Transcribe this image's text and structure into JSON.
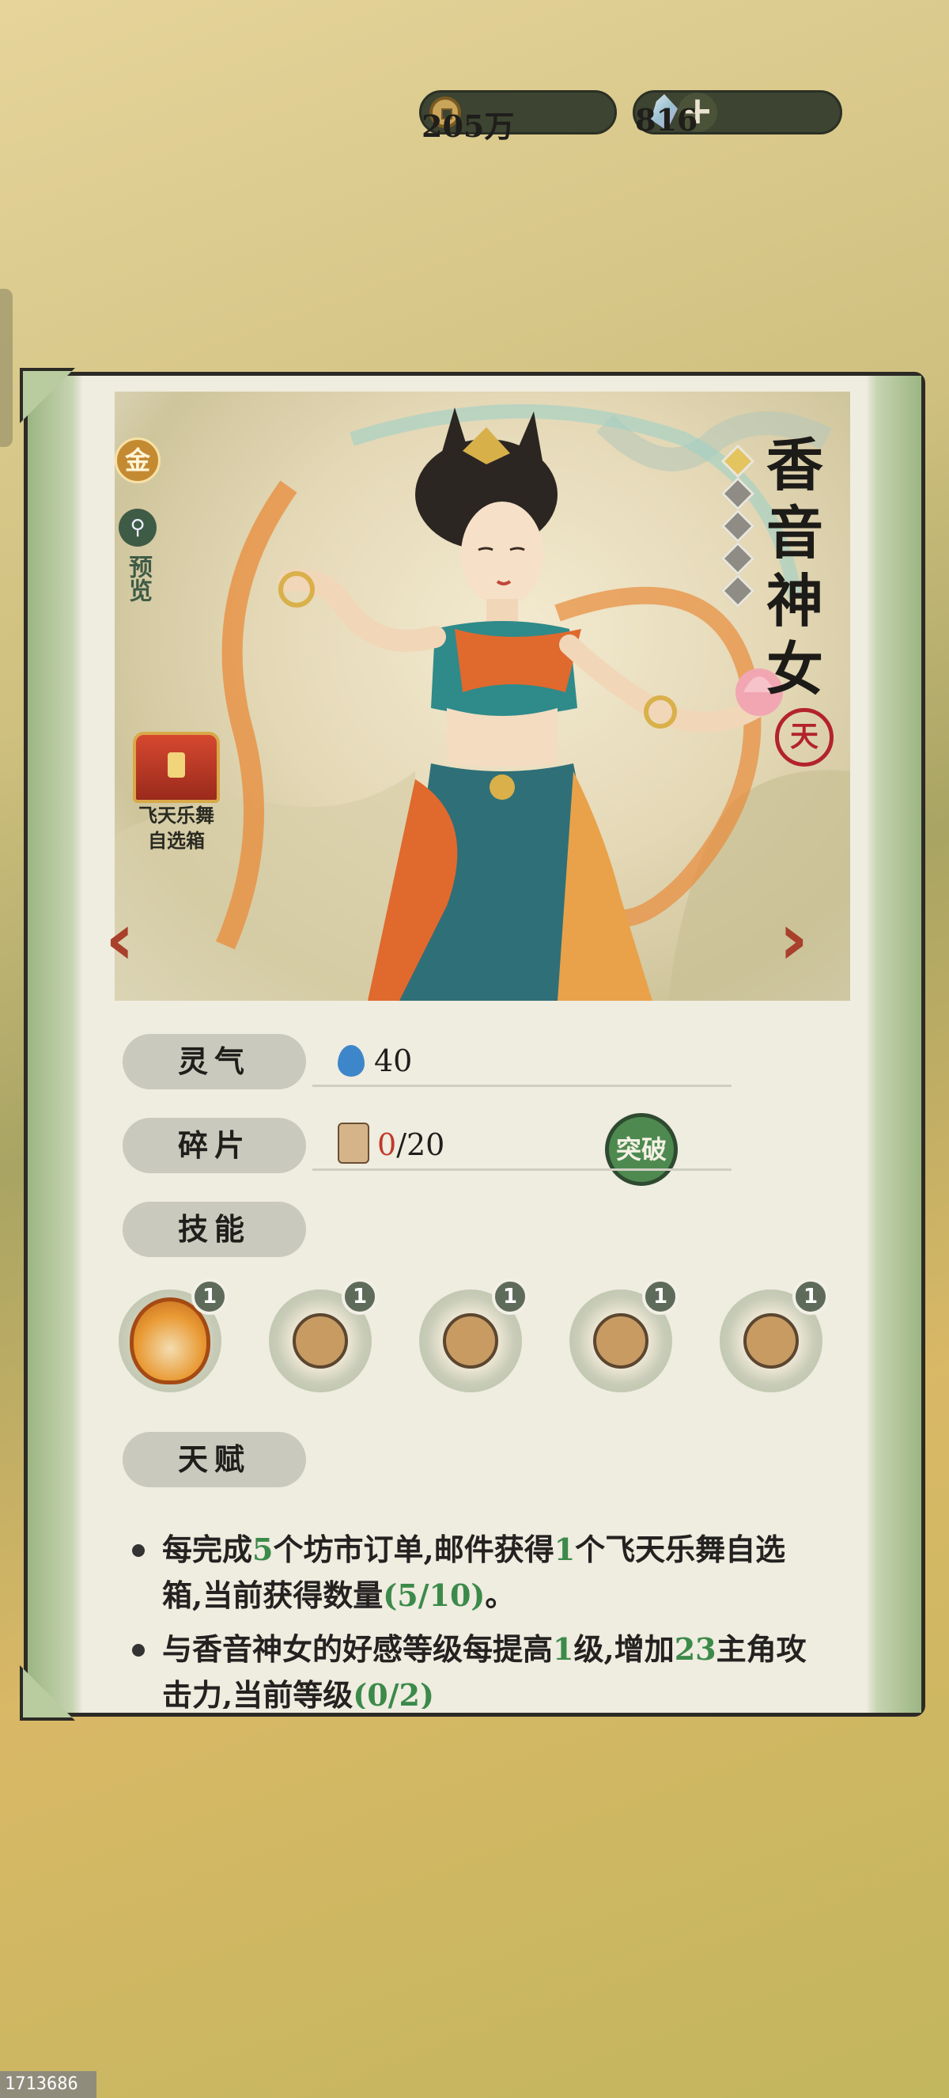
{
  "currency": {
    "coins": "205万",
    "gems": "816",
    "plus_icon": "plus-icon"
  },
  "character": {
    "grade": "金",
    "preview_label": "预览",
    "chest_label_line1": "飞天乐舞",
    "chest_label_line2": "自选箱",
    "name": "香音神女",
    "seal": "天",
    "stars_total": 5,
    "stars_lit": 1
  },
  "stats": {
    "lingqi_label": "灵气",
    "lingqi_value": "40",
    "fragment_label": "碎片",
    "fragment_current": "0",
    "fragment_total": "/20",
    "breakthrough_label": "突破",
    "skills_label": "技能"
  },
  "skills": [
    {
      "level": "1"
    },
    {
      "level": "1"
    },
    {
      "level": "1"
    },
    {
      "level": "1"
    },
    {
      "level": "1"
    }
  ],
  "talent": {
    "label": "天赋",
    "p1_a": "每完成",
    "p1_n1": "5",
    "p1_b": "个坊市订单,邮件获得",
    "p1_n2": "1",
    "p1_c": "个飞天乐舞自选箱,当前获得数量",
    "p1_n3": "(5/10)",
    "p1_d": "。",
    "p2_a": "与香音神女的好感等级每提高",
    "p2_n1": "1",
    "p2_b": "级,增加",
    "p2_n2": "23",
    "p2_c": "主角攻击力,当前等级",
    "p2_n3": "(0/2)"
  },
  "footer_id": "1713686",
  "colors": {
    "accent_green": "#3c8a4a",
    "accent_red": "#c0392b",
    "breakthrough_bg": "#4e8a50"
  }
}
